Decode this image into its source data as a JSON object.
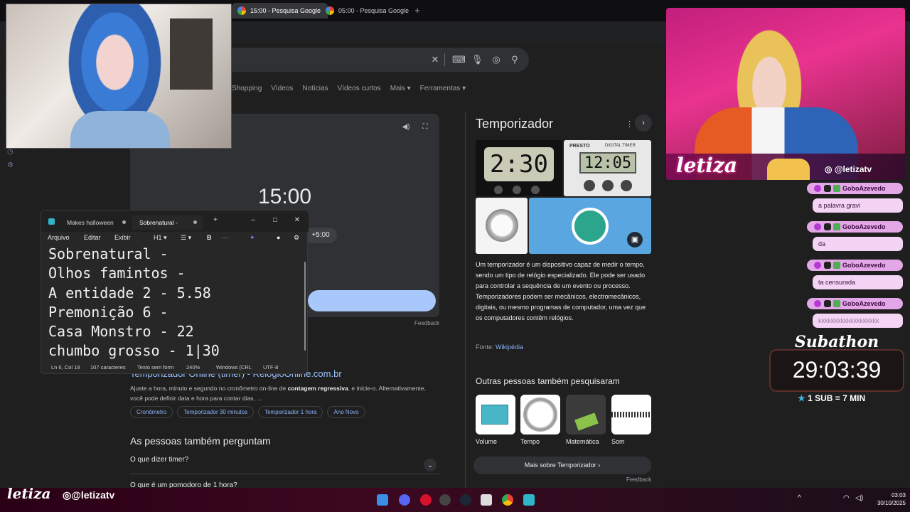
{
  "browser": {
    "tabs": [
      {
        "label": "15:00 - Pesquisa Google",
        "active": true
      },
      {
        "label": "05:00 - Pesquisa Google",
        "active": false
      }
    ],
    "new_tab": "+"
  },
  "search": {
    "nav": [
      "Shopping",
      "Vídeos",
      "Notícias",
      "Vídeos curtos",
      "Mais ▾",
      "Ferramentas ▾"
    ]
  },
  "timer_widget": {
    "display": "15:00",
    "add_button": "+5:00",
    "feedback": "Feedback"
  },
  "notepad": {
    "tabs": [
      "Makes halloween",
      "Sobrenatural -"
    ],
    "menu": [
      "Arquivo",
      "Editar",
      "Exibir",
      "H1 ▾",
      "☰ ▾",
      "B",
      "···"
    ],
    "lines": [
      "Sobrenatural -",
      "Olhos famintos -",
      "A entidade 2 - 5.58",
      "Premonição 6 -",
      "Casa Monstro - 22",
      "chumbo grosso - 1|30"
    ],
    "status": [
      "Ln 6, Col 18",
      "107 caracteres",
      "Texto sem form",
      "240%",
      "Windows (CRL",
      "UTF-8"
    ]
  },
  "result": {
    "title": "Temporizador Online (timer) - RelógioOnline.com.br",
    "snippet_pre": "Ajuste a hora, minuto e segundo no cronômetro on-line de ",
    "snippet_bold": "contagem regressiva",
    "snippet_post": ", e inicie-o. Alternativamente, você pode definir data e hora para contar dias, ...",
    "chips": [
      "Cronômetro",
      "Temporizador 30 minutos",
      "Temporizador 1 hora",
      "Ano Novo"
    ]
  },
  "paa": {
    "title": "As pessoas também perguntam",
    "questions": [
      "O que dizer timer?",
      "O que é um pomodoro de 1 hora?"
    ]
  },
  "knowledge_panel": {
    "title": "Temporizador",
    "img1_text": "2:30",
    "img2_brand": "PRESTO",
    "img2_sub": "DIGITAL TIMER",
    "img2_text": "12:05",
    "description": "Um temporizador é um dispositivo capaz de medir o tempo, sendo um tipo de relógio especializado. Ele pode ser usado para controlar a sequência de um evento ou processo. Temporizadores podem ser mecânicos, electromecânicos, digitais, ou mesmo programas de computador, uma vez que os computadores contêm relógios.",
    "source_label": "Fonte: ",
    "source_link": "Wikipédia",
    "also_title": "Outras pessoas também pesquisaram",
    "also": [
      "Volume",
      "Tempo",
      "Matemática",
      "Som"
    ],
    "more_button": "Mais sobre Temporizador",
    "feedback": "Feedback"
  },
  "overlay": {
    "brand": "letiza",
    "instagram": "@letizatv",
    "chat": [
      {
        "user": "GoboAzevedo",
        "message": "a palavra gravi"
      },
      {
        "user": "GoboAzevedo",
        "message": "da"
      },
      {
        "user": "GoboAzevedo",
        "message": "ta censurada"
      },
      {
        "user": "GoboAzevedo",
        "message": "kkkkkkkkkkkkkkkkkkk"
      }
    ],
    "subathon_title": "Subathon",
    "subathon_time": "29:03:39",
    "subathon_rate": "1 SUB = 7 MIN"
  },
  "taskbar": {
    "time": "03:03",
    "date": "30/10/2025"
  }
}
